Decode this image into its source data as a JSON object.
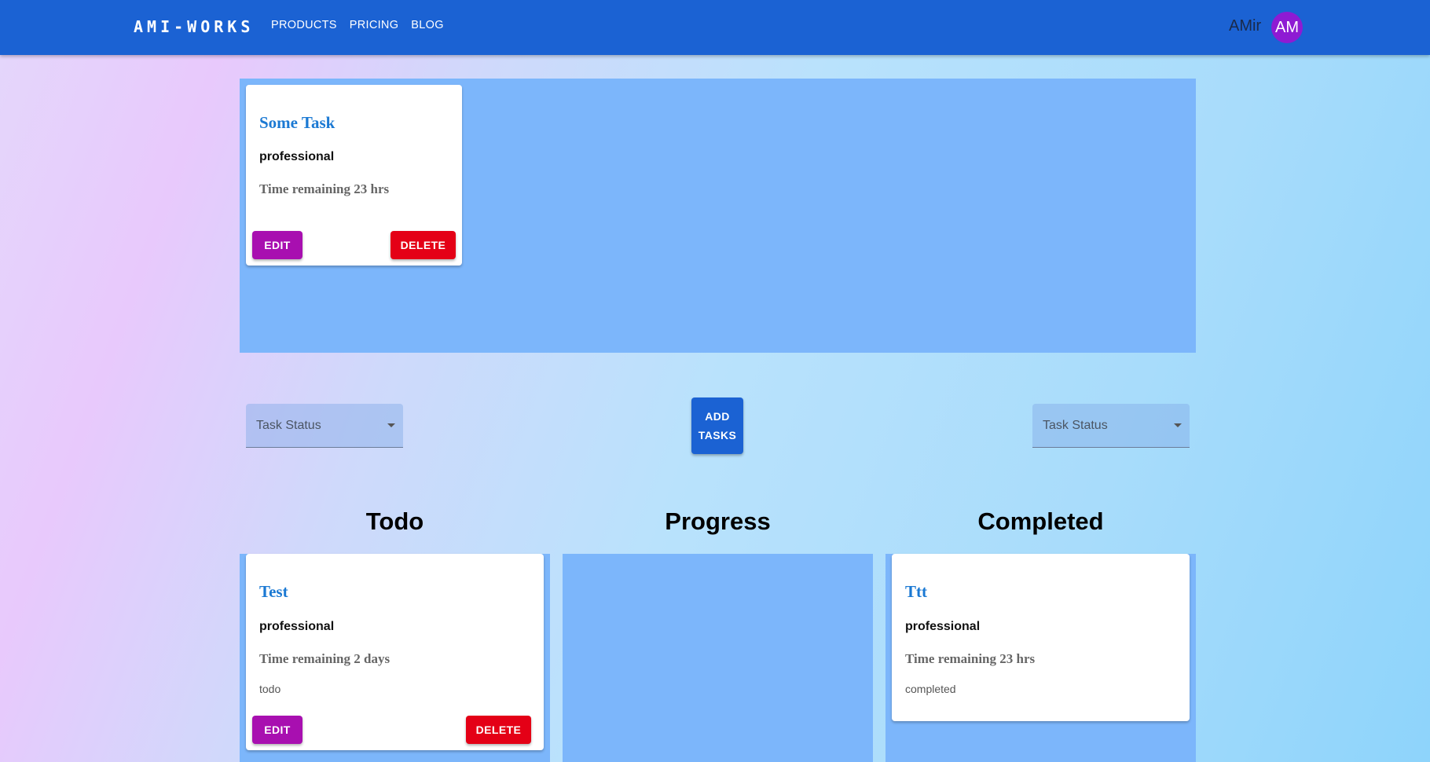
{
  "header": {
    "logo": "AMI-WORKS",
    "nav": [
      "PRODUCTS",
      "PRICING",
      "BLOG"
    ],
    "user_name": "AMir",
    "avatar_initials": "AM"
  },
  "colors": {
    "appbar": "#1b62d3",
    "panel": "#7cb6fb",
    "title_link": "#1b79d3",
    "edit_button": "#a80fb0",
    "delete_button": "#e40016",
    "avatar": "#8e1bd3"
  },
  "featured": {
    "cards": [
      {
        "title": "Some Task",
        "category": "professional",
        "time": "Time remaining 23 hrs",
        "edit_label": "EDIT",
        "delete_label": "DELETE"
      }
    ]
  },
  "controls": {
    "left_select_label": "Task Status",
    "add_button_line1": "ADD",
    "add_button_line2": "TASKS",
    "right_select_label": "Task Status"
  },
  "columns": [
    {
      "heading": "Todo",
      "cards": [
        {
          "title": "Test",
          "category": "professional",
          "time": "Time remaining 2 days",
          "status": "todo",
          "edit_label": "EDIT",
          "delete_label": "DELETE"
        }
      ]
    },
    {
      "heading": "Progress",
      "cards": []
    },
    {
      "heading": "Completed",
      "cards": [
        {
          "title": "Ttt",
          "category": "professional",
          "time": "Time remaining 23 hrs",
          "status": "completed"
        }
      ]
    }
  ]
}
